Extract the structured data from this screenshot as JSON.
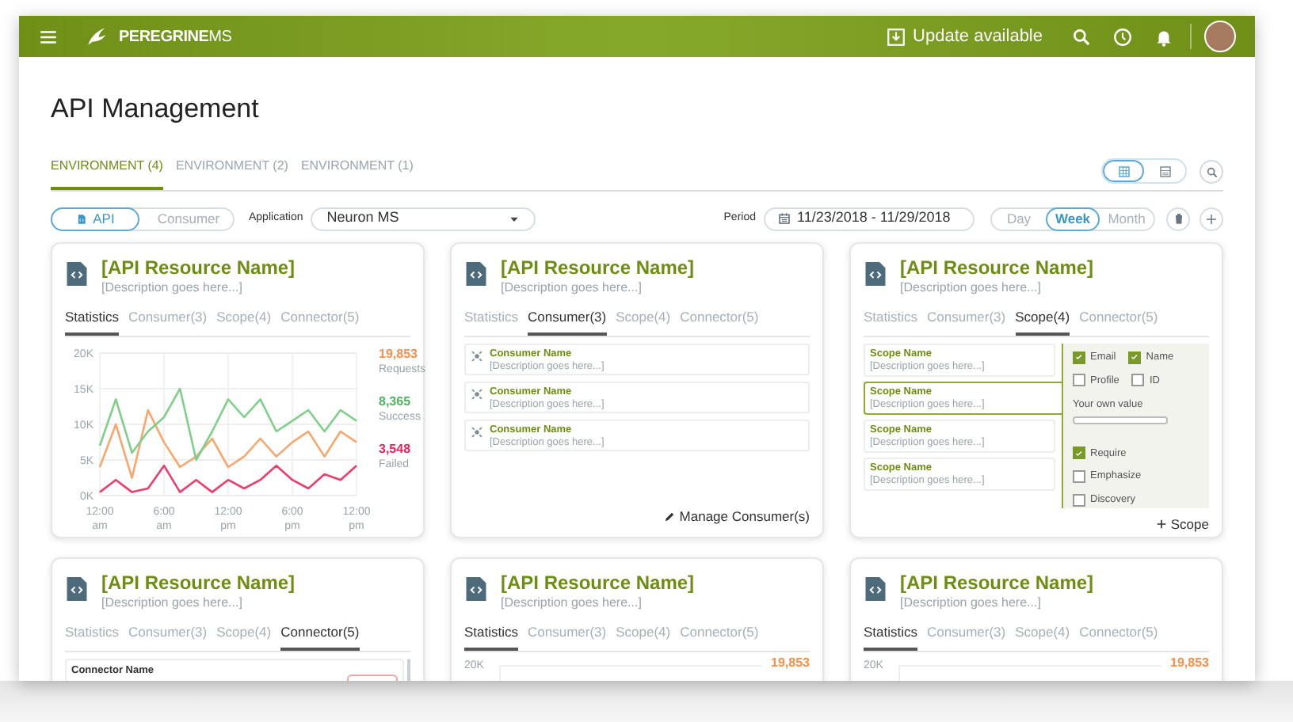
{
  "header": {
    "logo": "**PEREGRINE**MS",
    "update": "Update available"
  },
  "page_title": "API Management",
  "environment_tabs": [
    {
      "label": "ENVIRONMENT (4)",
      "selected": true
    },
    {
      "label": "ENVIRONMENT (2)",
      "selected": false
    },
    {
      "label": "ENVIRONMENT (1)",
      "selected": false
    }
  ],
  "view_toggle": [
    {
      "kind": "grid",
      "selected": true
    },
    {
      "kind": "list",
      "selected": false
    }
  ],
  "type_toggle": [
    {
      "label": "API",
      "kind": "api",
      "selected": true
    },
    {
      "label": "Consumer",
      "kind": "consumer",
      "selected": false
    }
  ],
  "application": {
    "label": "Application",
    "value": "Neuron MS"
  },
  "period": {
    "label": "Period",
    "value": "11/23/2018 - 11/29/2018"
  },
  "range_toggle": [
    {
      "label": "Day",
      "selected": false
    },
    {
      "label": "Week",
      "selected": true
    },
    {
      "label": "Month",
      "selected": false
    }
  ],
  "cards": [
    {
      "kind": "statistics",
      "title": "[API Resource Name]",
      "description": "[Description goes here...]",
      "tabs": [
        {
          "label": "Statistics",
          "selected": true
        },
        {
          "label": "Consumer(3)",
          "selected": false
        },
        {
          "label": "Scope(4)",
          "selected": false
        },
        {
          "label": "Connector(5)",
          "selected": false
        }
      ],
      "chart_data": {
        "type": "line",
        "grid": true,
        "categories": [
          "12:00 am",
          null,
          null,
          null,
          "6:00 am",
          null,
          null,
          null,
          "12:00 pm",
          null,
          null,
          null,
          "6:00 pm",
          null,
          null,
          null,
          "12:00 pm"
        ],
        "ylim": [
          0,
          20000
        ],
        "yticks": [
          {
            "value": 0,
            "label": "0K"
          },
          {
            "value": 5000,
            "label": "5K"
          },
          {
            "value": 10000,
            "label": "10K"
          },
          {
            "value": 15000,
            "label": "15K"
          },
          {
            "value": 20000,
            "label": "20K"
          }
        ],
        "series": [
          {
            "name": "Requests",
            "color": "#f9a66c",
            "values": [
              4000,
              10000,
              2500,
              12000,
              7500,
              4000,
              5500,
              8000,
              4000,
              5500,
              8000,
              5500,
              7500,
              9000,
              5500,
              9000,
              7500
            ]
          },
          {
            "name": "Success",
            "color": "#7fcf8a",
            "values": [
              7000,
              13500,
              6000,
              9000,
              11000,
              15000,
              5000,
              9000,
              13500,
              11000,
              13500,
              9000,
              10500,
              12000,
              9000,
              12000,
              10500
            ]
          },
          {
            "name": "Failed",
            "color": "#ec3d6b",
            "values": [
              500,
              2200,
              500,
              1000,
              4200,
              500,
              2200,
              500,
              2200,
              1000,
              2200,
              4200,
              2200,
              1000,
              3000,
              2200,
              4200
            ]
          }
        ]
      },
      "legend": [
        {
          "value": "19,853",
          "color": "#f98f4a"
        },
        {
          "value": "8,365",
          "color": "#4cb85c"
        },
        {
          "value": "3,548",
          "color": "#e8245a"
        }
      ]
    },
    {
      "kind": "consumer",
      "title": "[API Resource Name]",
      "description": "[Description goes here...]",
      "tabs": [
        {
          "label": "Statistics",
          "selected": false
        },
        {
          "label": "Consumer(3)",
          "selected": true
        },
        {
          "label": "Scope(4)",
          "selected": false
        },
        {
          "label": "Connector(5)",
          "selected": false
        }
      ],
      "items": [
        {
          "name": "Consumer Name",
          "description": "[Description goes here...]"
        },
        {
          "name": "Consumer Name",
          "description": "[Description goes here...]"
        },
        {
          "name": "Consumer Name",
          "description": "[Description goes here...]"
        }
      ],
      "action": "Manage Consumer(s)"
    },
    {
      "kind": "scope",
      "title": "[API Resource Name]",
      "description": "[Description goes here...]",
      "tabs": [
        {
          "label": "Statistics",
          "selected": false
        },
        {
          "label": "Consumer(3)",
          "selected": false
        },
        {
          "label": "Scope(4)",
          "selected": true
        },
        {
          "label": "Connector(5)",
          "selected": false
        }
      ],
      "items": [
        {
          "name": "Scope Name",
          "description": "[Description goes here...]",
          "selected": false
        },
        {
          "name": "Scope Name",
          "description": "[Description goes here...]",
          "selected": true
        },
        {
          "name": "Scope Name",
          "description": "[Description goes here...]",
          "selected": false
        },
        {
          "name": "Scope Name",
          "description": "[Description goes here...]",
          "selected": false
        }
      ],
      "options_top": [
        {
          "label": "Email",
          "checked": true
        },
        {
          "label": "Name",
          "checked": true
        },
        {
          "label": "Profile",
          "checked": false
        },
        {
          "label": "ID",
          "checked": false
        }
      ],
      "own_value_label": "Your own value",
      "options_bottom": [
        {
          "label": "Require",
          "checked": true
        },
        {
          "label": "Emphasize",
          "checked": false
        },
        {
          "label": "Discovery",
          "checked": false
        }
      ],
      "action": "Scope"
    },
    {
      "kind": "connector",
      "title": "[API Resource Name]",
      "description": "[Description goes here...]",
      "tabs": [
        {
          "label": "Statistics",
          "selected": false
        },
        {
          "label": "Consumer(3)",
          "selected": false
        },
        {
          "label": "Scope(4)",
          "selected": false
        },
        {
          "label": "Connector(5)",
          "selected": true
        }
      ],
      "items": [
        {
          "name": "Connector Name"
        }
      ]
    },
    {
      "kind": "statistics",
      "title": "[API Resource Name]",
      "description": "[Description goes here...]",
      "tabs": [
        {
          "label": "Statistics",
          "selected": true
        },
        {
          "label": "Consumer(3)",
          "selected": false
        },
        {
          "label": "Scope(4)",
          "selected": false
        },
        {
          "label": "Connector(5)",
          "selected": false
        }
      ],
      "axis_top": "20K",
      "legend": [
        {
          "value": "19,853",
          "color": "#f98f4a"
        }
      ]
    },
    {
      "kind": "statistics",
      "title": "[API Resource Name]",
      "description": "[Description goes here...]",
      "tabs": [
        {
          "label": "Statistics",
          "selected": true
        },
        {
          "label": "Consumer(3)",
          "selected": false
        },
        {
          "label": "Scope(4)",
          "selected": false
        },
        {
          "label": "Connector(5)",
          "selected": false
        }
      ],
      "axis_top": "20K",
      "legend": [
        {
          "value": "19,853",
          "color": "#f98f4a"
        }
      ]
    }
  ]
}
